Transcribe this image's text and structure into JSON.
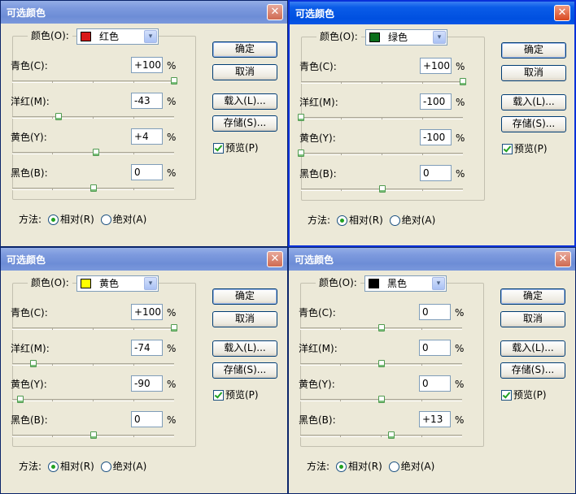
{
  "dialogs": [
    {
      "title": "可选颜色",
      "close_glyph": "✕",
      "color_label": "颜色(O):",
      "selected_color": "红色",
      "swatch_color": "#d81818",
      "combo_arrow": "▾",
      "sliders": [
        {
          "label": "青色(C):",
          "value": "+100",
          "unit": "%",
          "level": 100
        },
        {
          "label": "洋红(M):",
          "value": "-43",
          "unit": "%",
          "level": -43
        },
        {
          "label": "黄色(Y):",
          "value": "+4",
          "unit": "%",
          "level": 4
        },
        {
          "label": "黑色(B):",
          "value": "0",
          "unit": "%",
          "level": 0
        }
      ],
      "buttons": {
        "ok": "确定",
        "cancel": "取消",
        "load": "载入(L)...",
        "save": "存储(S)..."
      },
      "preview_label": "预览(P)",
      "preview_checked": true,
      "method_label": "方法:",
      "method_relative": "相对(R)",
      "method_absolute": "绝对(A)",
      "method_selected": "relative",
      "active": false
    },
    {
      "title": "可选颜色",
      "close_glyph": "✕",
      "color_label": "颜色(O):",
      "selected_color": "绿色",
      "swatch_color": "#0a6e1a",
      "combo_arrow": "▾",
      "sliders": [
        {
          "label": "青色(C):",
          "value": "+100",
          "unit": "%",
          "level": 100
        },
        {
          "label": "洋红(M):",
          "value": "-100",
          "unit": "%",
          "level": -100
        },
        {
          "label": "黄色(Y):",
          "value": "-100",
          "unit": "%",
          "level": -100
        },
        {
          "label": "黑色(B):",
          "value": "0",
          "unit": "%",
          "level": 0
        }
      ],
      "buttons": {
        "ok": "确定",
        "cancel": "取消",
        "load": "载入(L)...",
        "save": "存储(S)..."
      },
      "preview_label": "预览(P)",
      "preview_checked": true,
      "method_label": "方法:",
      "method_relative": "相对(R)",
      "method_absolute": "绝对(A)",
      "method_selected": "relative",
      "active": true
    },
    {
      "title": "可选颜色",
      "close_glyph": "✕",
      "color_label": "颜色(O):",
      "selected_color": "黄色",
      "swatch_color": "#ffff00",
      "combo_arrow": "▾",
      "sliders": [
        {
          "label": "青色(C):",
          "value": "+100",
          "unit": "%",
          "level": 100
        },
        {
          "label": "洋红(M):",
          "value": "-74",
          "unit": "%",
          "level": -74
        },
        {
          "label": "黄色(Y):",
          "value": "-90",
          "unit": "%",
          "level": -90
        },
        {
          "label": "黑色(B):",
          "value": "0",
          "unit": "%",
          "level": 0
        }
      ],
      "buttons": {
        "ok": "确定",
        "cancel": "取消",
        "load": "载入(L)...",
        "save": "存储(S)..."
      },
      "preview_label": "预览(P)",
      "preview_checked": true,
      "method_label": "方法:",
      "method_relative": "相对(R)",
      "method_absolute": "绝对(A)",
      "method_selected": "relative",
      "active": false
    },
    {
      "title": "可选颜色",
      "close_glyph": "✕",
      "color_label": "颜色(O):",
      "selected_color": "黑色",
      "swatch_color": "#000000",
      "combo_arrow": "▾",
      "sliders": [
        {
          "label": "青色(C):",
          "value": "0",
          "unit": "%",
          "level": 0
        },
        {
          "label": "洋红(M):",
          "value": "0",
          "unit": "%",
          "level": 0
        },
        {
          "label": "黄色(Y):",
          "value": "0",
          "unit": "%",
          "level": 0
        },
        {
          "label": "黑色(B):",
          "value": "+13",
          "unit": "%",
          "level": 13
        }
      ],
      "buttons": {
        "ok": "确定",
        "cancel": "取消",
        "load": "载入(L)...",
        "save": "存储(S)..."
      },
      "preview_label": "预览(P)",
      "preview_checked": true,
      "method_label": "方法:",
      "method_relative": "相对(R)",
      "method_absolute": "绝对(A)",
      "method_selected": "relative",
      "active": false
    }
  ]
}
